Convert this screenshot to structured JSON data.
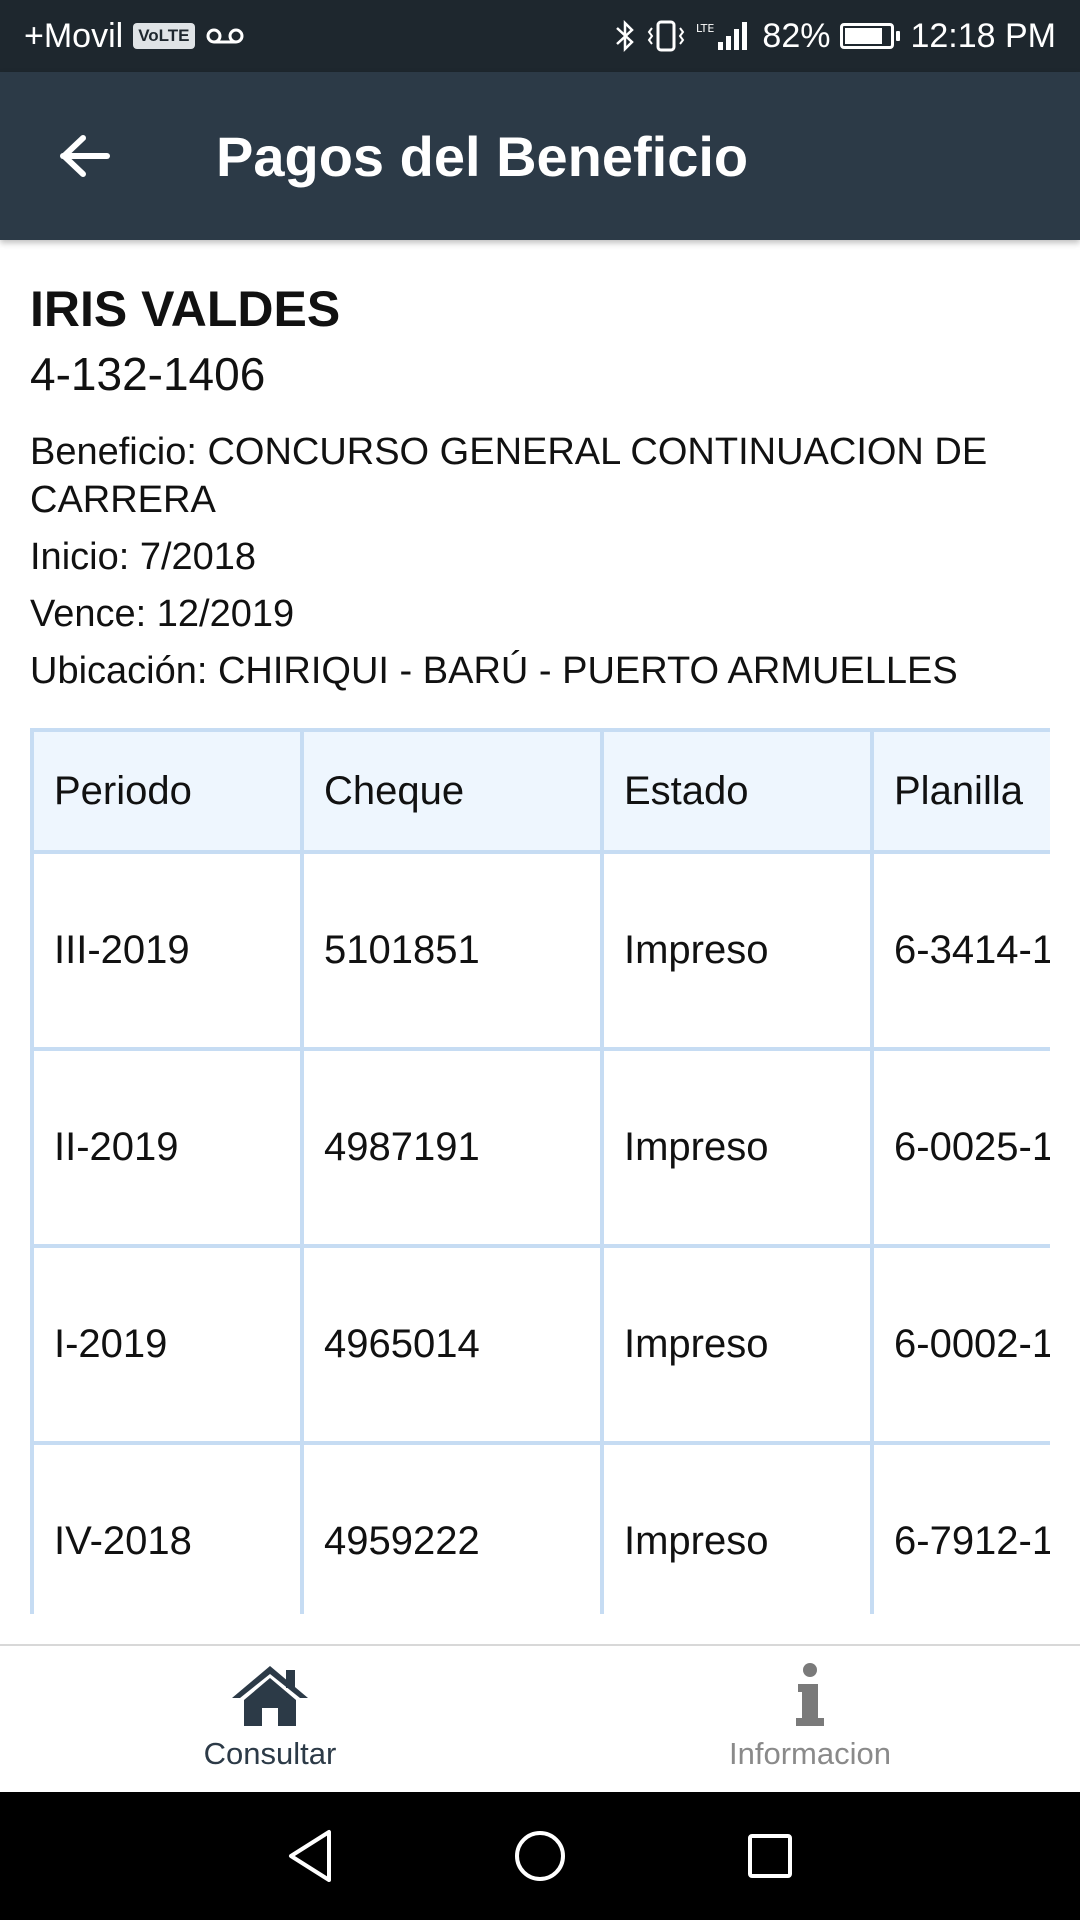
{
  "status_bar": {
    "carrier": "+Movil",
    "volte": "VoLTE",
    "network": "LTE",
    "battery_text": "82%",
    "battery_level": 0.82,
    "time": "12:18 PM"
  },
  "app_bar": {
    "title": "Pagos del Beneficio",
    "back_icon": "arrow-left-icon"
  },
  "person": {
    "name": "IRIS VALDES",
    "id_number": "4-132-1406"
  },
  "details": {
    "beneficio": "Beneficio: CONCURSO GENERAL CONTINUACION DE CARRERA",
    "inicio": "Inicio: 7/2018",
    "vence": "Vence: 12/2019",
    "ubicacion": "Ubicación: CHIRIQUI - BARÚ - PUERTO ARMUELLES"
  },
  "table": {
    "headers": [
      "Periodo",
      "Cheque",
      "Estado",
      "Planilla"
    ],
    "rows": [
      [
        "III-2019",
        "5101851",
        "Impreso",
        "6-3414-1"
      ],
      [
        "II-2019",
        "4987191",
        "Impreso",
        "6-0025-1"
      ],
      [
        "I-2019",
        "4965014",
        "Impreso",
        "6-0002-1"
      ],
      [
        "IV-2018",
        "4959222",
        "Impreso",
        "6-7912-1"
      ]
    ]
  },
  "bottom_nav": {
    "items": [
      {
        "label": "Consultar",
        "icon": "home-icon",
        "active": true
      },
      {
        "label": "Informacion",
        "icon": "info-icon",
        "active": false
      }
    ]
  },
  "colors": {
    "status_bar": "#1e272e",
    "app_bar": "#2c3a47",
    "table_border": "#c6dcf3",
    "table_header_bg": "#eef6fe",
    "nav_active": "#2c3a47",
    "nav_inactive": "#8a8a8a"
  }
}
